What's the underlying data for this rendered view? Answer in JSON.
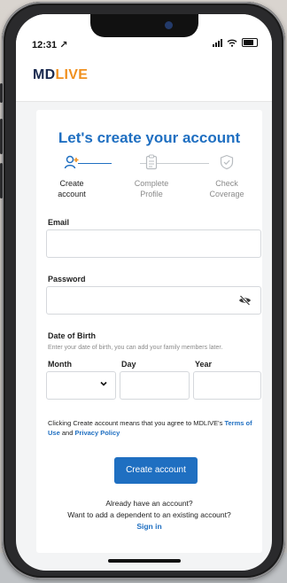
{
  "status_bar": {
    "time": "12:31 ↗"
  },
  "header": {
    "logo_part1": "MD",
    "logo_part2": "LIVE",
    "colors": {
      "navy": "#1a2a4f",
      "orange": "#f0901e"
    }
  },
  "page": {
    "title": "Let's create your account",
    "accent": "#1f6fc1"
  },
  "steps": [
    {
      "line1": "Create",
      "line2": "account",
      "active": true,
      "icon": "person-add-icon"
    },
    {
      "line1": "Complete",
      "line2": "Profile",
      "active": false,
      "icon": "clipboard-icon"
    },
    {
      "line1": "Check",
      "line2": "Coverage",
      "active": false,
      "icon": "shield-check-icon"
    }
  ],
  "form": {
    "email_label": "Email",
    "email_value": "",
    "password_label": "Password",
    "password_value": "",
    "dob_label": "Date of Birth",
    "dob_hint": "Enter your date of birth, you can add your family members later.",
    "month_label": "Month",
    "day_label": "Day",
    "year_label": "Year"
  },
  "terms": {
    "text": "Clicking Create account means that you agree to MDLIVE's ",
    "terms_link": "Terms of Use",
    "and": " and ",
    "privacy_link": "Privacy Policy"
  },
  "cta": {
    "label": "Create account"
  },
  "footer": {
    "line1": "Already have an account?",
    "line2": "Want to add a dependent to an existing account?",
    "signin": "Sign in"
  }
}
